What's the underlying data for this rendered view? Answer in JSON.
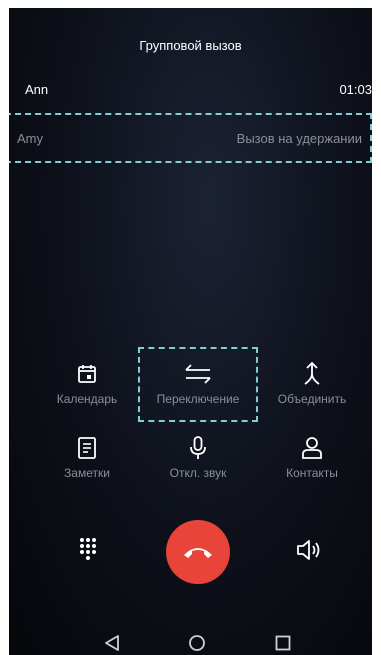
{
  "header": {
    "title": "Групповой вызов"
  },
  "active_call": {
    "name": "Ann",
    "duration": "01:03"
  },
  "held_call": {
    "name": "Amy",
    "status": "Вызов на удержании"
  },
  "actions": {
    "calendar": "Календарь",
    "switch": "Переключение",
    "merge": "Объединить",
    "notes": "Заметки",
    "mute": "Откл. звук",
    "contacts": "Контакты"
  },
  "colors": {
    "end_call": "#e8443a",
    "highlight": "#7fd0d4",
    "muted_text": "#8b8f98"
  },
  "icons": {
    "keypad": "keypad-icon",
    "end_call": "end-call-icon",
    "speaker": "speaker-icon",
    "back": "back-icon",
    "home": "home-icon",
    "recents": "recents-icon"
  }
}
